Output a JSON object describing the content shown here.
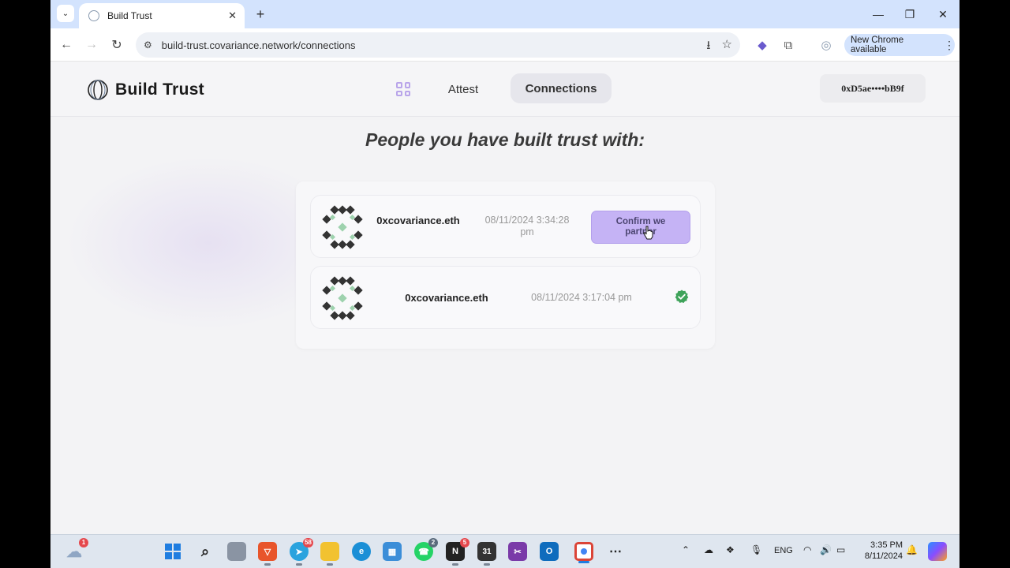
{
  "browser": {
    "tab_title": "Build Trust",
    "url": "build-trust.covariance.network/connections",
    "update_pill": "New Chrome available"
  },
  "site": {
    "brand": "Build Trust",
    "nav": {
      "attest": "Attest",
      "connections": "Connections"
    },
    "wallet": "0xD5ae••••bB9f"
  },
  "main": {
    "heading": "People you have built trust with:",
    "connections": [
      {
        "name": "0xcovariance.eth",
        "timestamp": "08/11/2024 3:34:28 pm",
        "action_label": "Confirm we partner",
        "status": "pending"
      },
      {
        "name": "0xcovariance.eth",
        "timestamp": "08/11/2024 3:17:04 pm",
        "status": "confirmed"
      }
    ]
  },
  "taskbar": {
    "weather_badge": "1",
    "telegram_badge": "58",
    "whatsapp_badge": "2",
    "notion_badge": "5",
    "calendar_day": "31",
    "language": "ENG",
    "time": "3:35 PM",
    "date": "8/11/2024"
  },
  "colors": {
    "accent": "#c5b3f5",
    "check_green": "#3fa35a",
    "tabstrip": "#d3e3fd"
  }
}
